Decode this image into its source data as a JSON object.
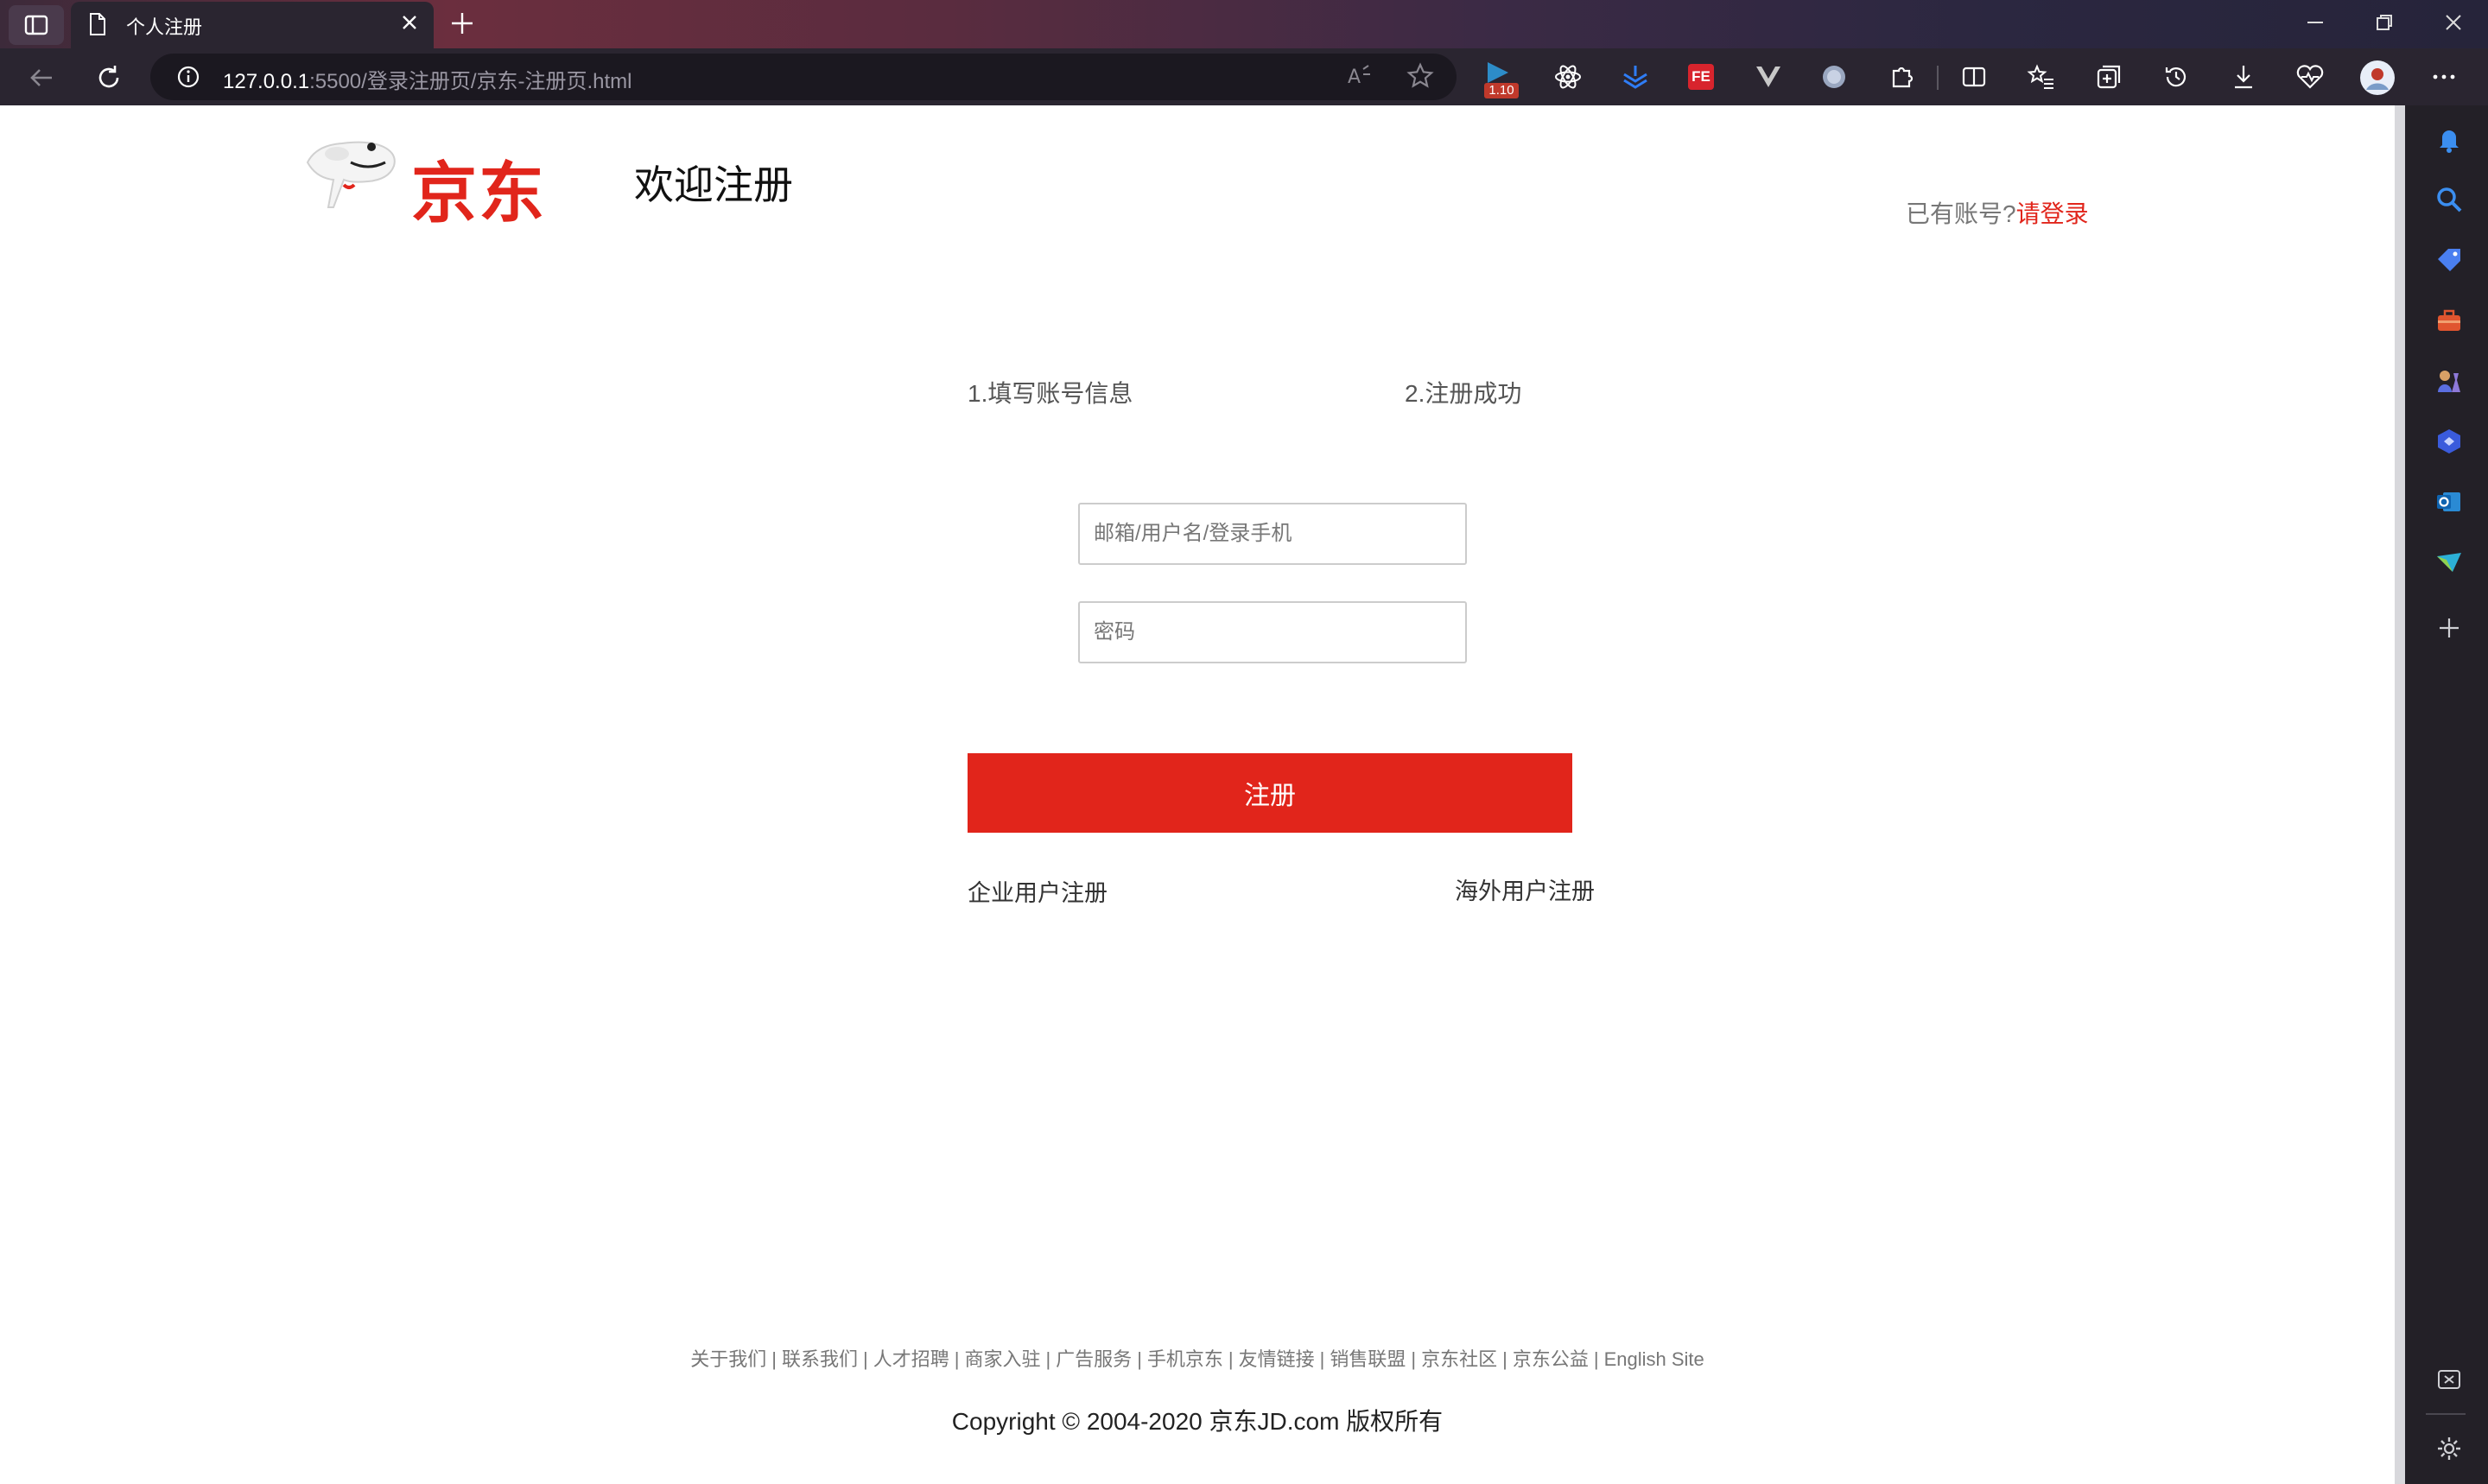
{
  "browser": {
    "tab_title": "个人注册",
    "url_host": "127.0.0.1",
    "url_rest": ":5500/登录注册页/京东-注册页.html",
    "extension_badge": "1.10",
    "fe_badge": "FE"
  },
  "header": {
    "logo_text": "京东",
    "welcome": "欢迎注册",
    "has_account": "已有账号?",
    "login_link": "请登录"
  },
  "steps": {
    "step1": "1.填写账号信息",
    "step2": "2.注册成功"
  },
  "form": {
    "username_placeholder": "邮箱/用户名/登录手机",
    "password_placeholder": "密码",
    "register_label": "注册"
  },
  "links": {
    "enterprise": "企业用户注册",
    "overseas": "海外用户注册"
  },
  "footer": {
    "links": [
      "关于我们",
      "联系我们",
      "人才招聘",
      "商家入驻",
      "广告服务",
      "手机京东",
      "友情链接",
      "销售联盟",
      "京东社区",
      "京东公益",
      "English Site"
    ],
    "separator": "|",
    "copyright": "Copyright © 2004-2020 京东JD.com 版权所有"
  },
  "colors": {
    "brand_red": "#e1251b",
    "muted_text": "#777777"
  }
}
